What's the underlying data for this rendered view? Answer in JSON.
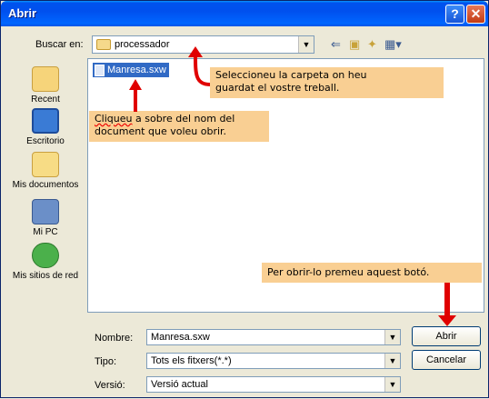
{
  "window": {
    "title": "Abrir"
  },
  "colors": {
    "titlebar": "#0055e5",
    "callout_bg": "#f9cf93",
    "arrow": "#e00000",
    "selection": "#316ac5"
  },
  "lookin": {
    "label": "Buscar en:",
    "value": "processador"
  },
  "places": [
    {
      "label": "Recent",
      "icon": "recent-folder-icon"
    },
    {
      "label": "Escritorio",
      "icon": "desktop-icon"
    },
    {
      "label": "Mis documentos",
      "icon": "my-documents-icon"
    },
    {
      "label": "Mi PC",
      "icon": "my-computer-icon"
    },
    {
      "label": "Mis sitios de red",
      "icon": "network-places-icon"
    }
  ],
  "files": [
    {
      "name": "Manresa.sxw",
      "selected": true
    }
  ],
  "callouts": {
    "folder_line1": "Seleccioneu la carpeta on heu",
    "folder_line2": "guardat el vostre treball.",
    "doc_word1": "Cliqueu",
    "doc_rest1": " a sobre del nom del",
    "doc_line2": "document que voleu obrir.",
    "open_btn": "Per obrir-lo premeu aquest botó."
  },
  "fields": {
    "name_label": "Nombre:",
    "name_value": "Manresa.sxw",
    "type_label": "Tipo:",
    "type_value": "Tots els fitxers(*.*)",
    "version_label": "Versió:",
    "version_value": "Versió actual"
  },
  "buttons": {
    "open": "Abrir",
    "cancel": "Cancelar"
  }
}
